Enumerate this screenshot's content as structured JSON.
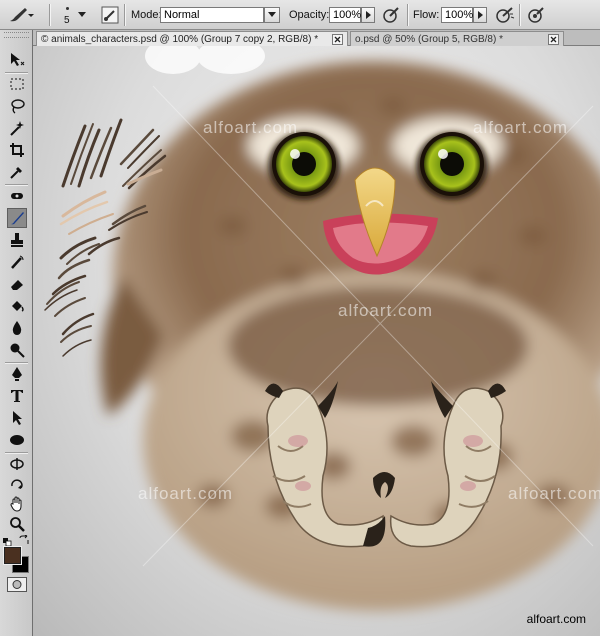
{
  "options_bar": {
    "brush_size": "5",
    "mode_label": "Mode:",
    "mode_value": "Normal",
    "opacity_label": "Opacity:",
    "opacity_value": "100%",
    "flow_label": "Flow:",
    "flow_value": "100%"
  },
  "tabs": [
    {
      "title": "© animals_characters.psd @ 100% (Group 7 copy 2, RGB/8) *",
      "active": true
    },
    {
      "title": "o.psd @ 50% (Group 5, RGB/8) *",
      "active": false
    }
  ],
  "canvas": {
    "watermarks": [
      "alfoart.com",
      "alfoart.com",
      "alfoart.com",
      "alfoart.com",
      "alfoart.com"
    ],
    "credit": "alfoart.com"
  },
  "colors": {
    "foreground": "#4a3020",
    "background": "#000000",
    "panel": "#d0d0d0"
  }
}
